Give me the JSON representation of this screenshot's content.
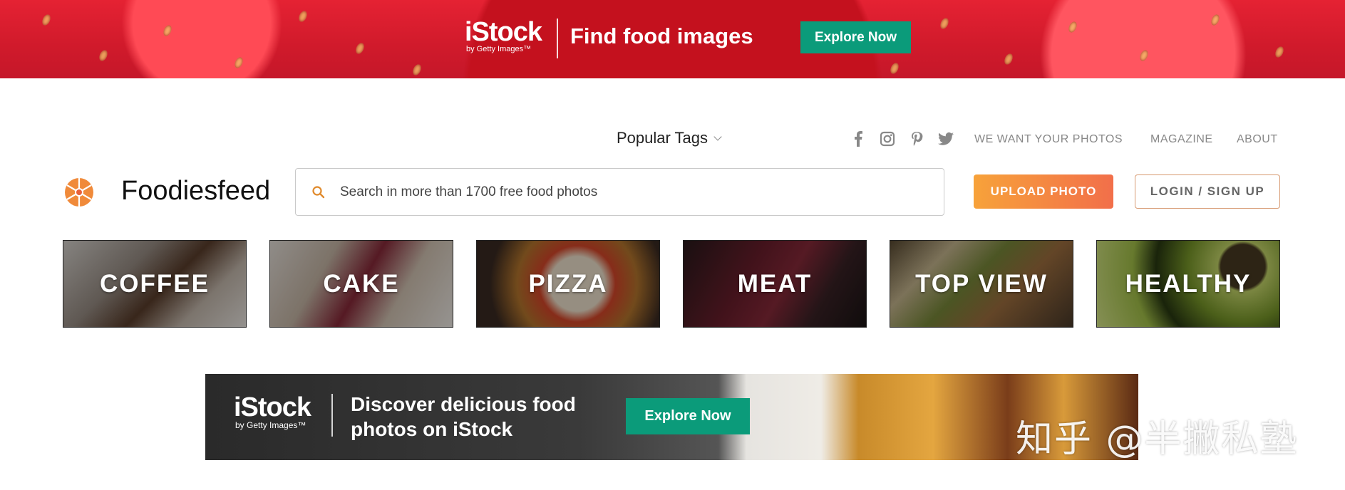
{
  "top_banner": {
    "brand": "iStock",
    "brand_sub": "by Getty Images™",
    "headline": "Find food images",
    "cta": "Explore Now"
  },
  "nav": {
    "popular_tags": "Popular Tags",
    "social_icons": [
      "facebook-icon",
      "instagram-icon",
      "pinterest-icon",
      "twitter-icon"
    ],
    "links": [
      "WE WANT YOUR PHOTOS",
      "MAGAZINE",
      "ABOUT"
    ]
  },
  "header": {
    "brand": "Foodiesfeed",
    "search_placeholder": "Search in more than 1700 free food photos",
    "upload_button": "UPLOAD PHOTO",
    "login_button": "LOGIN / SIGN UP"
  },
  "categories": [
    {
      "label": "COFFEE"
    },
    {
      "label": "CAKE"
    },
    {
      "label": "PIZZA"
    },
    {
      "label": "MEAT"
    },
    {
      "label": "TOP VIEW"
    },
    {
      "label": "HEALTHY"
    }
  ],
  "bottom_banner": {
    "brand": "iStock",
    "brand_sub": "by Getty Images™",
    "headline": "Discover delicious food photos on iStock",
    "cta": "Explore Now"
  },
  "watermark": "知乎 @半撇私塾",
  "colors": {
    "accent_green": "#0b9b7a",
    "upload_gradient_start": "#f7a23a",
    "upload_gradient_end": "#f26f4a",
    "logo_orange": "#f08a3a"
  }
}
